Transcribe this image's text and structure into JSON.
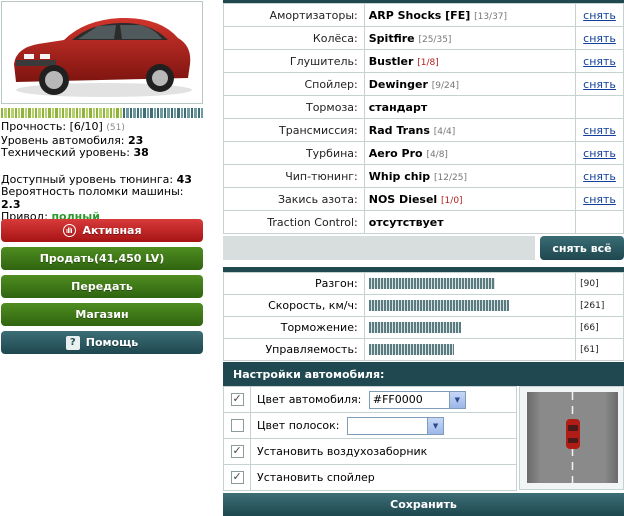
{
  "stats": {
    "durability_label": "Прочность:",
    "durability_value": "[6/10]",
    "durability_max": "(51)",
    "car_level_label": "Уровень автомобиля:",
    "car_level_value": "23",
    "tech_level_label": "Технический уровень:",
    "tech_level_value": "38",
    "tuning_label": "Доступный уровень тюнинга:",
    "tuning_value": "43",
    "breakdown_label": "Вероятность поломки машины:",
    "breakdown_value": "2.3",
    "drive_label": "Привод:",
    "drive_value": "полный",
    "durability_bar_fill": 0.6
  },
  "buttons": {
    "active": "Активная",
    "sell": "Продать(41,450 LV)",
    "transfer": "Передать",
    "shop": "Магазин",
    "help": "Помощь",
    "help_icon": "?",
    "remove_all": "снять всё",
    "save": "Сохранить"
  },
  "parts": [
    {
      "label": "Амортизаторы:",
      "value": "ARP Shocks [FE]",
      "count": "[13/37]",
      "action": "снять"
    },
    {
      "label": "Колёса:",
      "value": "Spitfire",
      "count": "[25/35]",
      "action": "снять"
    },
    {
      "label": "Глушитель:",
      "value": "Bustler",
      "count": "[1/8]",
      "action": "снять"
    },
    {
      "label": "Спойлер:",
      "value": "Dewinger",
      "count": "[9/24]",
      "action": "снять"
    },
    {
      "label": "Тормоза:",
      "value": "стандарт",
      "count": "",
      "action": ""
    },
    {
      "label": "Трансмиссия:",
      "value": "Rad Trans",
      "count": "[4/4]",
      "action": "снять"
    },
    {
      "label": "Турбина:",
      "value": "Aero Pro",
      "count": "[4/8]",
      "action": "снять"
    },
    {
      "label": "Чип-тюнинг:",
      "value": "Whip chip",
      "count": "[12/25]",
      "action": "снять"
    },
    {
      "label": "Закись азота:",
      "value": "NOS Diesel",
      "count": "[1/0]",
      "action": "снять"
    },
    {
      "label": "Traction Control:",
      "value": "отсутствует",
      "count": "",
      "action": ""
    }
  ],
  "performance": [
    {
      "label": "Разгон:",
      "value": "[90]",
      "level": 90
    },
    {
      "label": "Скорость, км/ч:",
      "value": "[261]",
      "level": 100
    },
    {
      "label": "Торможение:",
      "value": "[66]",
      "level": 66
    },
    {
      "label": "Управляемость:",
      "value": "[61]",
      "level": 61
    }
  ],
  "settings": {
    "title": "Настройки автомобиля:",
    "car_color_label": "Цвет автомобиля:",
    "car_color_value": "#FF0000",
    "stripes_label": "Цвет полосок:",
    "stripes_value": "",
    "air_intake_label": "Установить воздухозаборник",
    "spoiler_label": "Установить спойлер"
  },
  "colors": {
    "car": "#b01c16",
    "accent_dark": "#1f4850"
  }
}
